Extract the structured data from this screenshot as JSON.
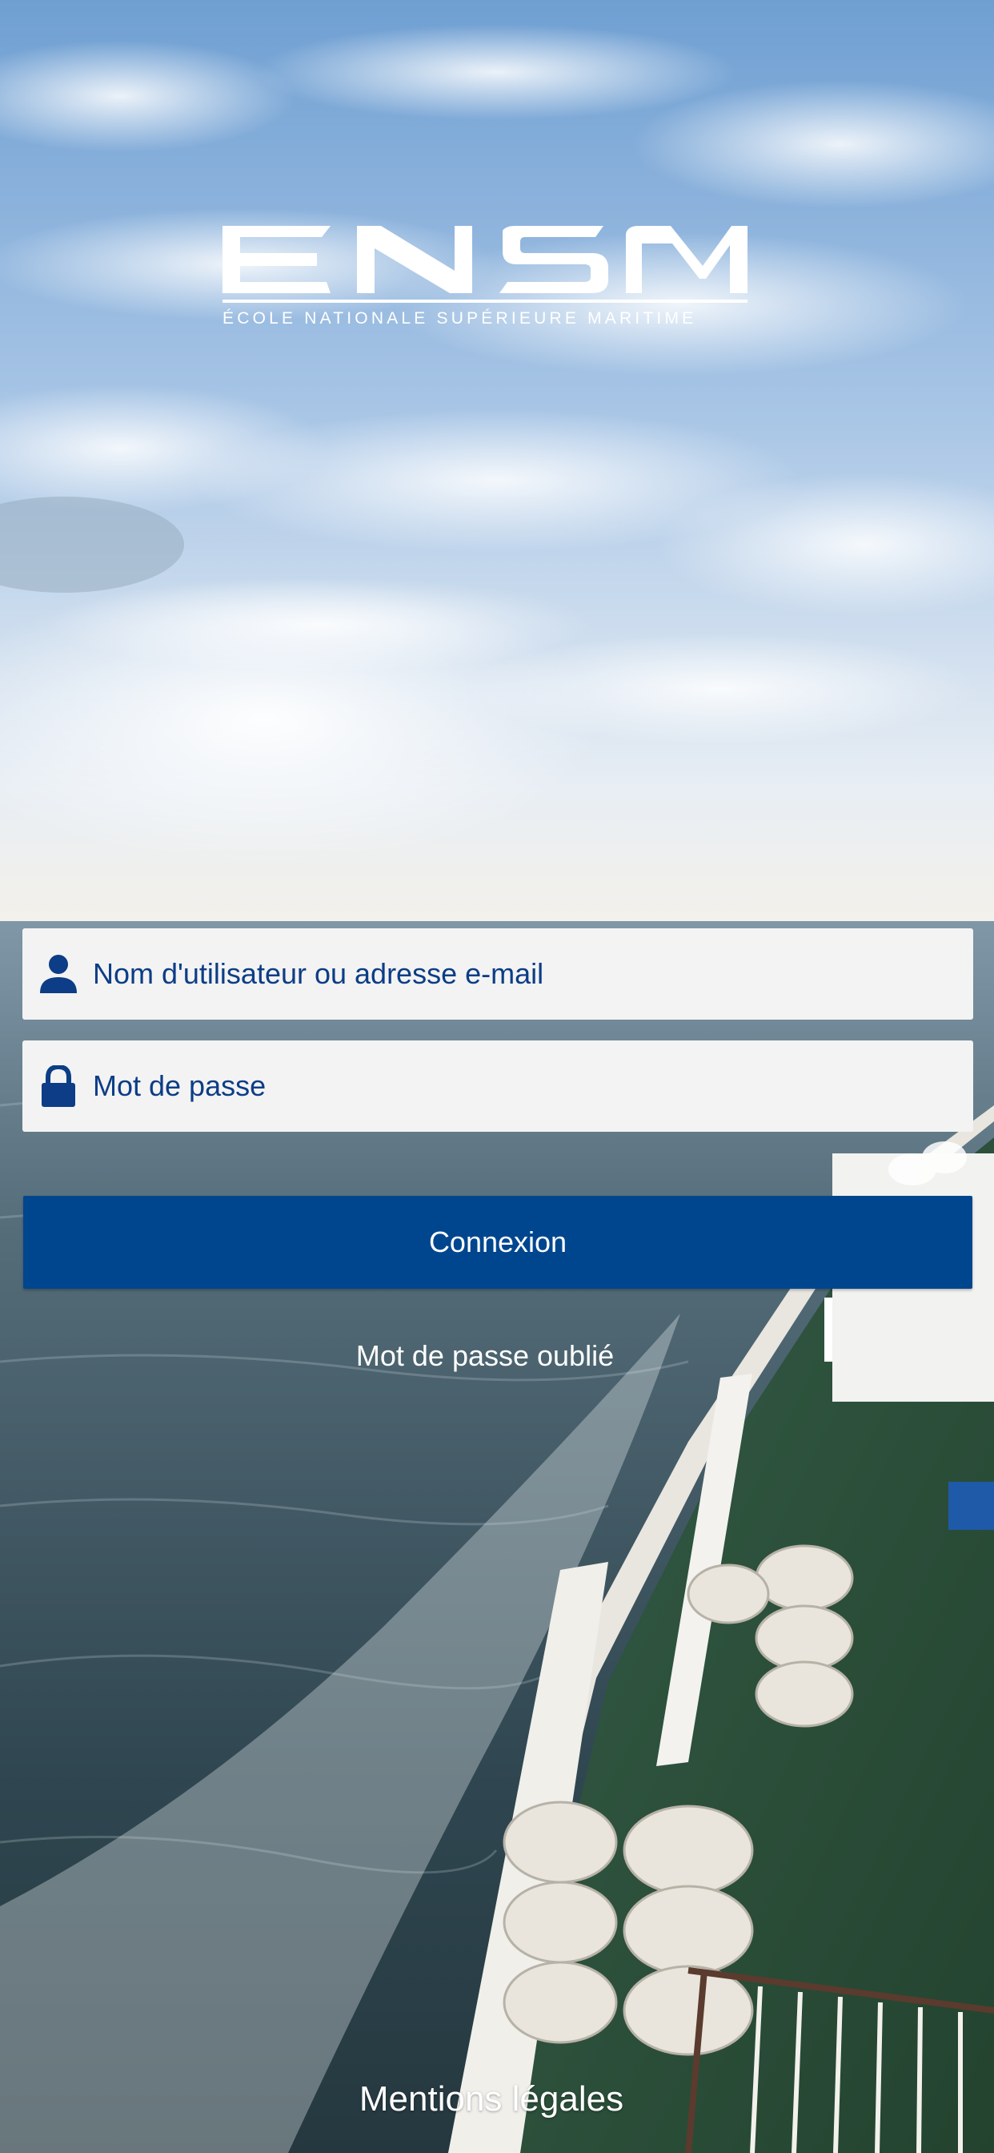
{
  "logo": {
    "wordmark": "ENSM",
    "subtitle": "ÉCOLE NATIONALE SUPÉRIEURE MARITIME"
  },
  "login": {
    "username_placeholder": "Nom d'utilisateur ou adresse e-mail",
    "password_placeholder": "Mot de passe",
    "submit_label": "Connexion",
    "forgot_label": "Mot de passe oublié"
  },
  "footer": {
    "legal_label": "Mentions légales"
  },
  "icons": {
    "username": "user-icon",
    "password": "lock-icon"
  },
  "colors": {
    "primary": "#00468f",
    "field_text": "#0c3d86",
    "field_bg": "#f3f3f3"
  }
}
